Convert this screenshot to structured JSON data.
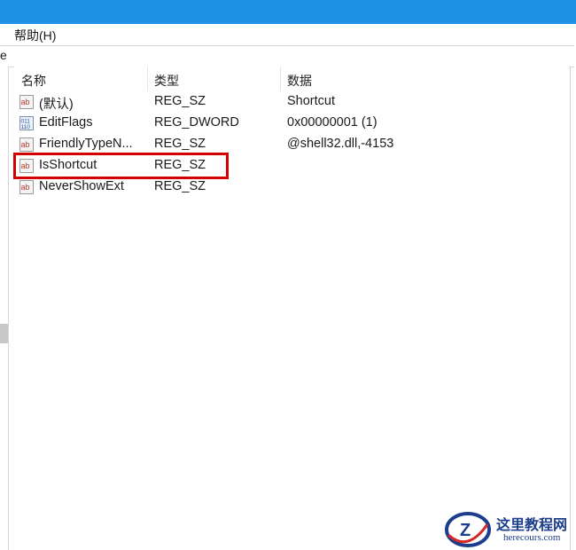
{
  "menu": {
    "help_label": "帮助(H)"
  },
  "address": {
    "text": "e"
  },
  "columns": {
    "name": "名称",
    "type": "类型",
    "data": "数据"
  },
  "rows": [
    {
      "icon": "string-value-icon",
      "name": "(默认)",
      "type": "REG_SZ",
      "data": "Shortcut"
    },
    {
      "icon": "binary-value-icon",
      "name": "EditFlags",
      "type": "REG_DWORD",
      "data": "0x00000001 (1)"
    },
    {
      "icon": "string-value-icon",
      "name": "FriendlyTypeN...",
      "type": "REG_SZ",
      "data": "@shell32.dll,-4153"
    },
    {
      "icon": "string-value-icon",
      "name": "IsShortcut",
      "type": "REG_SZ",
      "data": ""
    },
    {
      "icon": "string-value-icon",
      "name": "NeverShowExt",
      "type": "REG_SZ",
      "data": ""
    }
  ],
  "watermark": {
    "title": "这里教程网",
    "site": "herecours.com",
    "logo_letter": "Z"
  },
  "colors": {
    "titlebar": "#1e90e6",
    "highlight": "#d40000"
  }
}
